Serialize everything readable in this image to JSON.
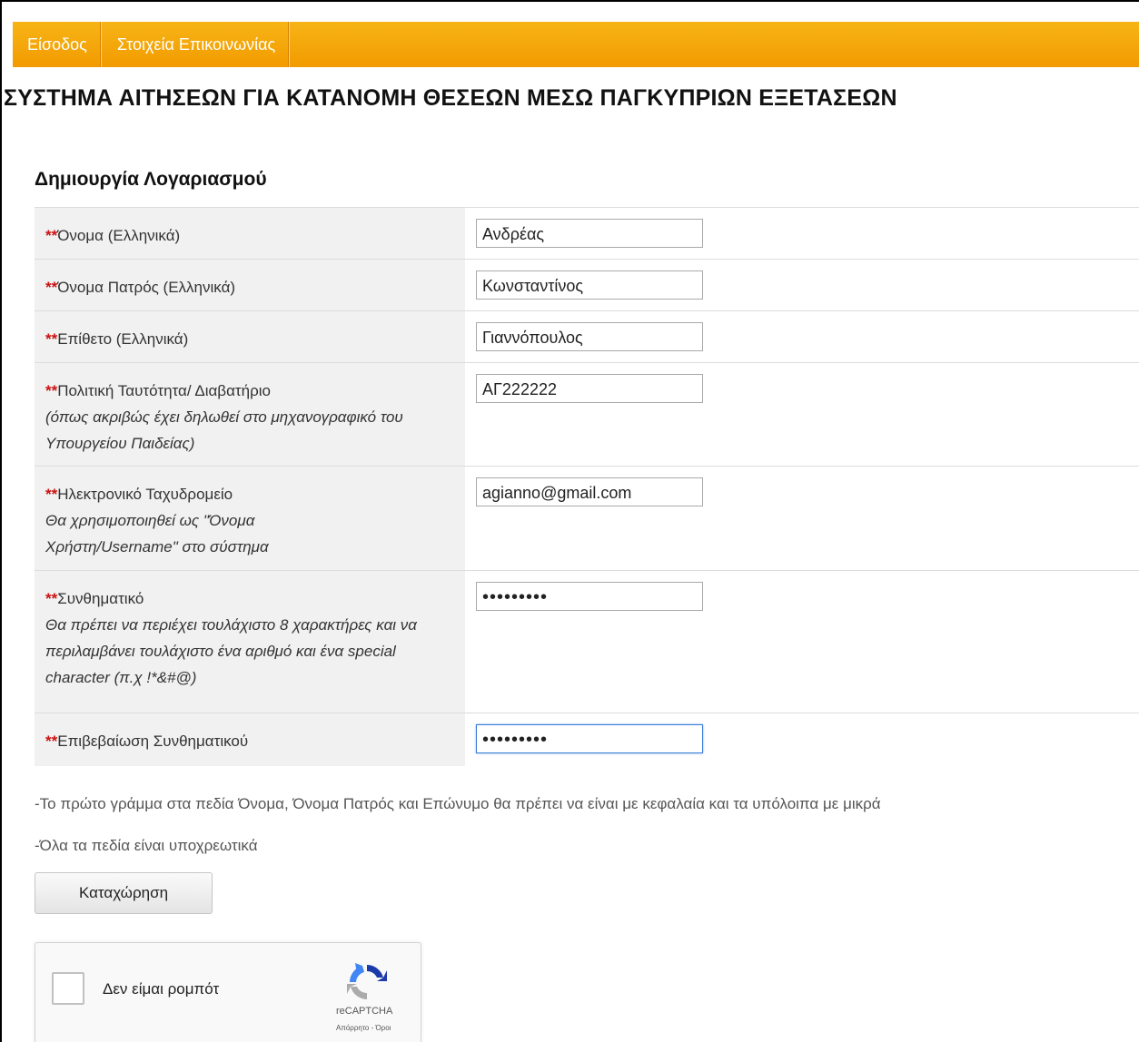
{
  "nav": {
    "items": [
      {
        "label": "Είσοδος"
      },
      {
        "label": "Στοιχεία Επικοινωνίας"
      }
    ]
  },
  "page": {
    "title": "ΣΥΣΤΗΜΑ ΑΙΤΗΣΕΩΝ ΓΙΑ ΚΑΤΑΝΟΜΗ ΘΕΣΕΩΝ ΜΕΣΩ ΠΑΓΚΥΠΡΙΩΝ ΕΞΕΤΑΣΕΩΝ",
    "section_title": "Δημιουργία Λογαριασμού"
  },
  "form": {
    "required_mark": "**",
    "fields": [
      {
        "label": "Όνομα (Ελληνικά)",
        "hint": "",
        "value": "Ανδρέας"
      },
      {
        "label": "Όνομα Πατρός (Ελληνικά)",
        "hint": "",
        "value": "Κωνσταντίνος"
      },
      {
        "label": "Επίθετο (Ελληνικά)",
        "hint": "",
        "value": "Γιαννόπουλος"
      },
      {
        "label": "Πολιτική Ταυτότητα/ Διαβατήριο",
        "hint": "(όπως ακριβώς έχει δηλωθεί στο μηχανογραφικό του Υπουργείου Παιδείας)",
        "value": "ΑΓ222222"
      },
      {
        "label": "Ηλεκτρονικό Ταχυδρομείο",
        "hint": "Θα χρησιμοποιηθεί ως \"Όνομα Χρήστη/Username\" στο σύστημα",
        "value": "agianno@gmail.com"
      },
      {
        "label": "Συνθηματικό",
        "hint": "Θα πρέπει να περιέχει τουλάχιστο 8 χαρακτήρες και να περιλαμβάνει τουλάχιστο ένα αριθμό και ένα special character (π.χ !*&#@)",
        "value": "•••••••••"
      },
      {
        "label": "Επιβεβαίωση Συνθηματικού",
        "hint": "",
        "value": "•••••••••"
      }
    ]
  },
  "notes": {
    "capitalization": "-Το πρώτο γράμμα στα πεδία Όνομα, Όνομα Πατρός και Επώνυμο θα πρέπει να είναι με κεφαλαία και τα υπόλοιπα με μικρά",
    "all_required": "-Όλα τα πεδία είναι υποχρεωτικά"
  },
  "submit": {
    "label": "Καταχώρηση"
  },
  "captcha": {
    "label": "Δεν είμαι ρομπότ",
    "brand": "reCAPTCHA",
    "links": "Απόρρητο - Όροι"
  },
  "colors": {
    "nav_bg": "#f29b00",
    "required": "#cc1111",
    "label_bg": "#f1f1f1"
  }
}
